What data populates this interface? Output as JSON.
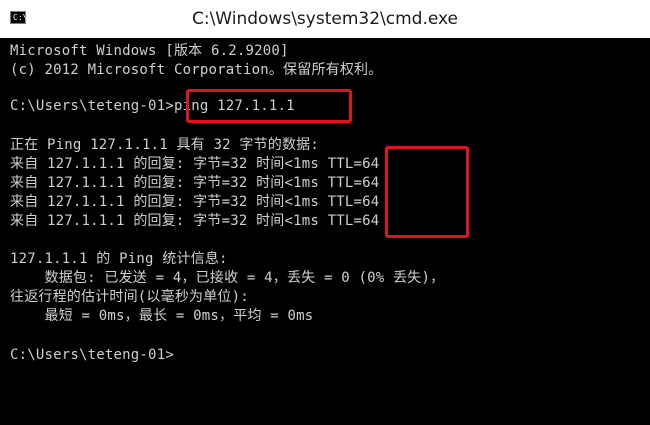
{
  "window": {
    "title": "C:\\Windows\\system32\\cmd.exe",
    "icon_text": "C:\\"
  },
  "console": {
    "lines": [
      "Microsoft Windows [版本 6.2.9200]",
      "(c) 2012 Microsoft Corporation。保留所有权利。",
      "C:\\Users\\teteng-01>ping 127.1.1.1",
      "正在 Ping 127.1.1.1 具有 32 字节的数据:",
      "来自 127.1.1.1 的回复: 字节=32 时间<1ms TTL=64",
      "来自 127.1.1.1 的回复: 字节=32 时间<1ms TTL=64",
      "来自 127.1.1.1 的回复: 字节=32 时间<1ms TTL=64",
      "来自 127.1.1.1 的回复: 字节=32 时间<1ms TTL=64",
      "127.1.1.1 的 Ping 统计信息:",
      "    数据包: 已发送 = 4，已接收 = 4，丢失 = 0 (0% 丢失)，",
      "往返行程的估计时间(以毫秒为单位):",
      "    最短 = 0ms，最长 = 0ms，平均 = 0ms",
      "C:\\Users\\teteng-01>"
    ]
  },
  "highlight_color": "#e0141e"
}
